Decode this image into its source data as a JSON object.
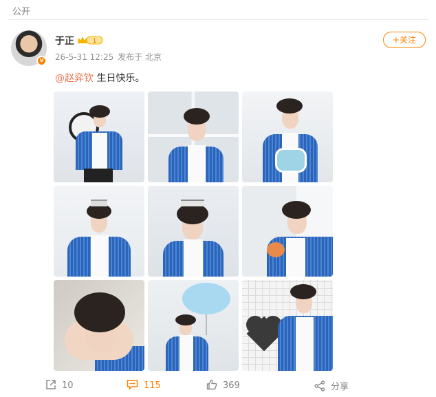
{
  "visibility": "公开",
  "post": {
    "username": "于正",
    "vip_level": "1",
    "timestamp": "26-5-31 12:25",
    "location": "发布于 北京",
    "mention": "@赵弈钦",
    "text": " 生日快乐。",
    "follow_label": "+关注"
  },
  "photos": [
    {
      "alt": "photo-1",
      "palette": "#eceff3"
    },
    {
      "alt": "photo-2",
      "palette": "#e8ebee"
    },
    {
      "alt": "photo-3",
      "palette": "#eef0f2"
    },
    {
      "alt": "photo-4",
      "palette": "#eef2f5"
    },
    {
      "alt": "photo-5",
      "palette": "#e6eaee"
    },
    {
      "alt": "photo-6",
      "palette": "#edeff0"
    },
    {
      "alt": "photo-7",
      "palette": "#d9d7d3"
    },
    {
      "alt": "photo-8",
      "palette": "#e9ecef"
    },
    {
      "alt": "photo-9",
      "palette": "#f0f1f2"
    }
  ],
  "actions": {
    "repost_count": "10",
    "comment_count": "115",
    "like_count": "369",
    "share_label": "分享"
  },
  "colors": {
    "accent": "#ff8200",
    "mention": "#eb7350"
  }
}
